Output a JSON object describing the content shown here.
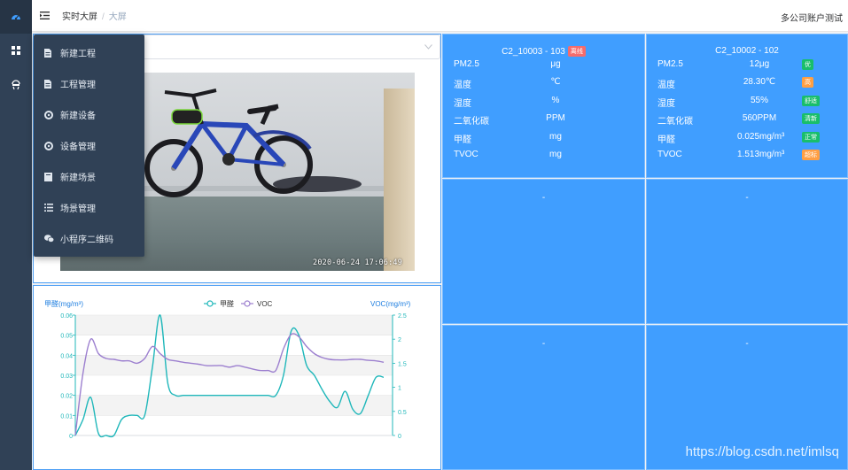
{
  "rail": {
    "items": [
      {
        "icon": "dashboard-icon",
        "active": true
      },
      {
        "icon": "grid-icon",
        "active": false
      },
      {
        "icon": "user-icon",
        "active": false
      }
    ]
  },
  "header": {
    "breadcrumb": [
      "实时大屏",
      "大屏"
    ],
    "separator": "/",
    "account": "多公司账户测试"
  },
  "menu": {
    "items": [
      {
        "label": "新建工程",
        "icon": "document-icon"
      },
      {
        "label": "工程管理",
        "icon": "document-icon"
      },
      {
        "label": "新建设备",
        "icon": "crosshair-icon"
      },
      {
        "label": "设备管理",
        "icon": "crosshair-icon"
      },
      {
        "label": "新建场景",
        "icon": "board-icon"
      },
      {
        "label": "场景管理",
        "icon": "list-icon"
      },
      {
        "label": "小程序二维码",
        "icon": "wechat-icon"
      }
    ]
  },
  "camera": {
    "timestamp": "2020-06-24 17:06:49"
  },
  "colors": {
    "tile": "#409eff",
    "rail": "#304156",
    "series_formaldehyde": "#1fb7ba",
    "series_voc": "#9c7fcf",
    "badge_offline": "#f56c6c",
    "badge_excellent": "#19be6b",
    "badge_high": "#ff9f43",
    "badge_fresh": "#19be6b",
    "badge_normal": "#19be6b",
    "badge_over": "#ff9f43"
  },
  "devices": [
    {
      "title": "C2_10003 - 103",
      "badge": "离线",
      "badge_color": "#f56c6c",
      "rows": [
        {
          "label": "PM2.5",
          "value": "μg",
          "badge": ""
        },
        {
          "label": "温度",
          "value": "℃",
          "badge": ""
        },
        {
          "label": "湿度",
          "value": "%",
          "badge": ""
        },
        {
          "label": "二氧化碳",
          "value": "PPM",
          "badge": ""
        },
        {
          "label": "甲醛",
          "value": "mg",
          "badge": ""
        },
        {
          "label": "TVOC",
          "value": "mg",
          "badge": ""
        }
      ]
    },
    {
      "title": "C2_10002 - 102",
      "badge": "",
      "badge_color": "",
      "rows": [
        {
          "label": "PM2.5",
          "value": "12μg",
          "badge": "优",
          "badge_color": "#19be6b"
        },
        {
          "label": "温度",
          "value": "28.30℃",
          "badge": "高",
          "badge_color": "#ff9f43"
        },
        {
          "label": "湿度",
          "value": "55%",
          "badge": "舒适",
          "badge_color": "#19be6b"
        },
        {
          "label": "二氧化碳",
          "value": "560PPM",
          "badge": "清新",
          "badge_color": "#19be6b"
        },
        {
          "label": "甲醛",
          "value": "0.025mg/m³",
          "badge": "正常",
          "badge_color": "#19be6b"
        },
        {
          "label": "TVOC",
          "value": "1.513mg/m³",
          "badge": "超标",
          "badge_color": "#ff9f43"
        }
      ]
    }
  ],
  "empty_tiles": [
    "-",
    "-",
    "-",
    "-"
  ],
  "watermark": "https://blog.csdn.net/imlsq",
  "chart_data": {
    "type": "line",
    "ylabel_left": "甲醛(mg/m³)",
    "ylabel_right": "VOC(mg/m³)",
    "left_ticks": [
      "0",
      "0.01",
      "0.02",
      "0.03",
      "0.04",
      "0.05",
      "0.06"
    ],
    "right_ticks": [
      "0",
      "0.5",
      "1",
      "1.5",
      "2",
      "2.5"
    ],
    "ylim_left": [
      0,
      0.06
    ],
    "ylim_right": [
      0,
      2.5
    ],
    "grid": true,
    "legend_position": "top-center",
    "series": [
      {
        "name": "甲醛",
        "axis": "left",
        "color": "#1fb7ba",
        "values": [
          0.0,
          0.008,
          0.019,
          0.001,
          0.0,
          0.0,
          0.008,
          0.01,
          0.01,
          0.01,
          0.034,
          0.06,
          0.026,
          0.02,
          0.02,
          0.02,
          0.02,
          0.02,
          0.02,
          0.02,
          0.02,
          0.02,
          0.02,
          0.02,
          0.02,
          0.02,
          0.02,
          0.03,
          0.052,
          0.05,
          0.035,
          0.03,
          0.023,
          0.017,
          0.014,
          0.022,
          0.013,
          0.011,
          0.02,
          0.029,
          0.029
        ]
      },
      {
        "name": "VOC",
        "axis": "right",
        "color": "#9c7fcf",
        "values": [
          0.0,
          1.3,
          2.0,
          1.7,
          1.6,
          1.58,
          1.55,
          1.55,
          1.5,
          1.6,
          1.85,
          1.7,
          1.58,
          1.55,
          1.52,
          1.5,
          1.48,
          1.45,
          1.45,
          1.45,
          1.42,
          1.45,
          1.42,
          1.38,
          1.35,
          1.35,
          1.35,
          1.8,
          2.1,
          2.05,
          1.85,
          1.7,
          1.62,
          1.58,
          1.57,
          1.57,
          1.58,
          1.58,
          1.56,
          1.55,
          1.52
        ]
      }
    ]
  }
}
